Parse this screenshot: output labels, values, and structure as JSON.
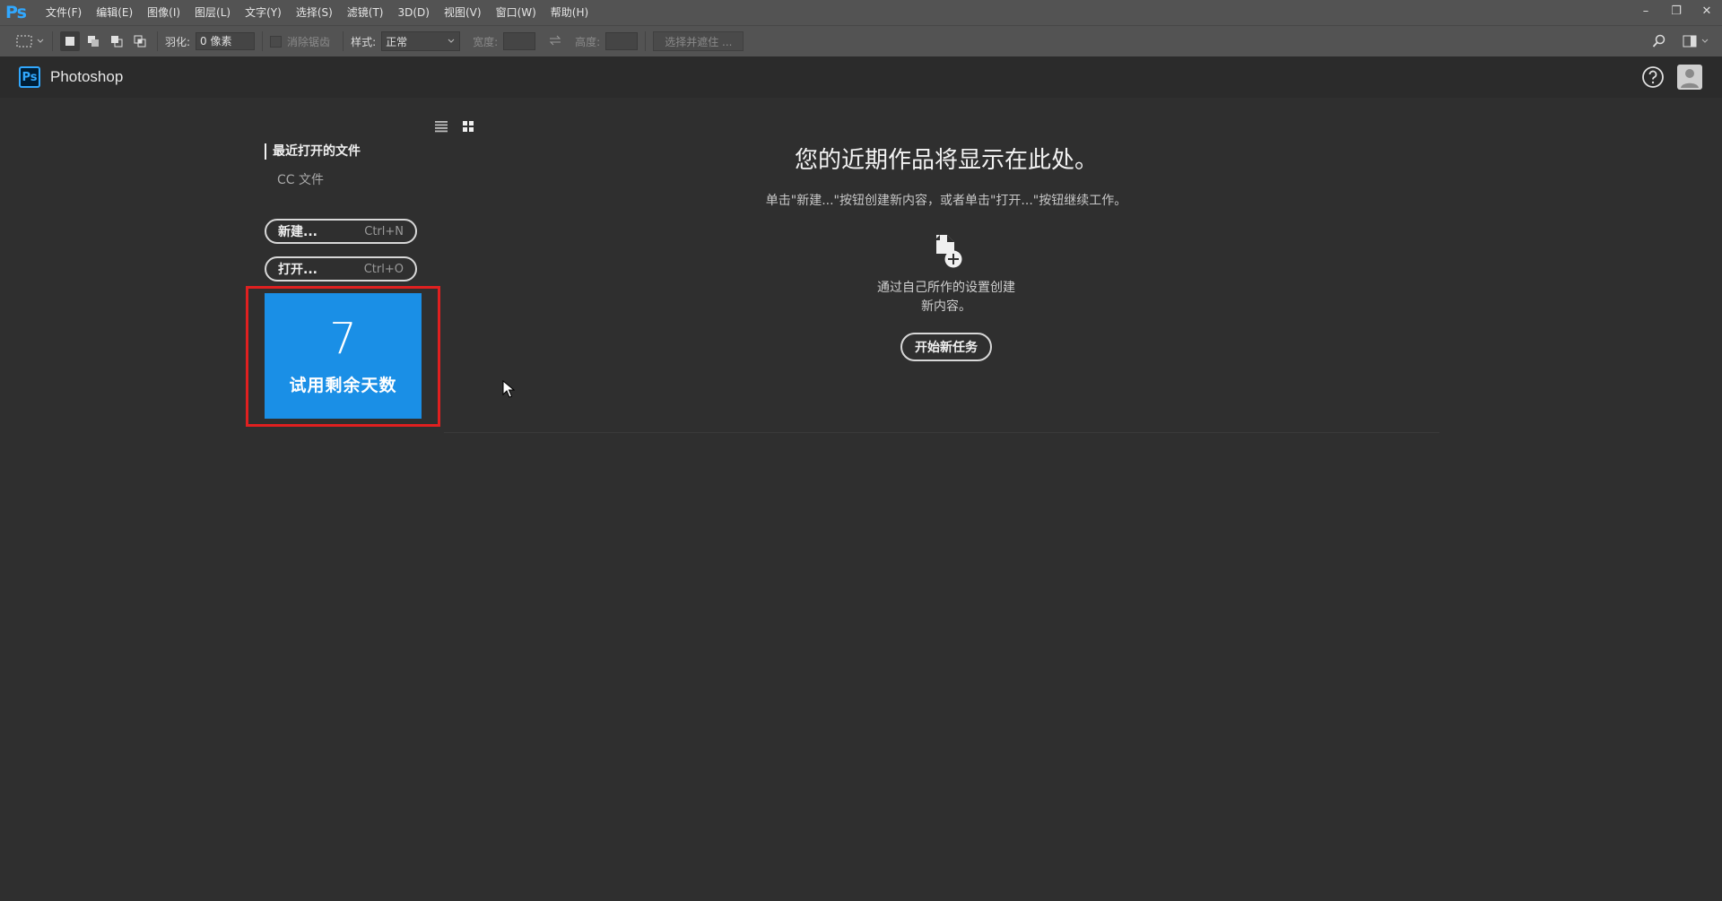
{
  "menubar": {
    "logo": "Ps",
    "items": [
      "文件(F)",
      "编辑(E)",
      "图像(I)",
      "图层(L)",
      "文字(Y)",
      "选择(S)",
      "滤镜(T)",
      "3D(D)",
      "视图(V)",
      "窗口(W)",
      "帮助(H)"
    ]
  },
  "window_controls": {
    "minimize": "–",
    "restore": "❐",
    "close": "✕"
  },
  "options": {
    "feather_label": "羽化:",
    "feather_value": "0 像素",
    "antialias_label": "消除锯齿",
    "style_label": "样式:",
    "style_value": "正常",
    "width_label": "宽度:",
    "height_label": "高度:",
    "select_mask_label": "选择并遮住 ..."
  },
  "app": {
    "icon_text": "Ps",
    "title": "Photoshop"
  },
  "sidebar": {
    "recent_label": "最近打开的文件",
    "cc_label": "CC 文件",
    "new_label": "新建...",
    "new_shortcut": "Ctrl+N",
    "open_label": "打开...",
    "open_shortcut": "Ctrl+O"
  },
  "trial": {
    "days": "7",
    "label": "试用剩余天数"
  },
  "main": {
    "heading": "您的近期作品将显示在此处。",
    "subtext": "单击\"新建...\"按钮创建新内容，或者单击\"打开...\"按钮继续工作。",
    "create_line1": "通过自己所作的设置创建",
    "create_line2": "新内容。",
    "start_button": "开始新任务"
  },
  "colors": {
    "accent": "#1a8fe6",
    "highlight": "#e02020",
    "background": "#2f2f2f"
  }
}
